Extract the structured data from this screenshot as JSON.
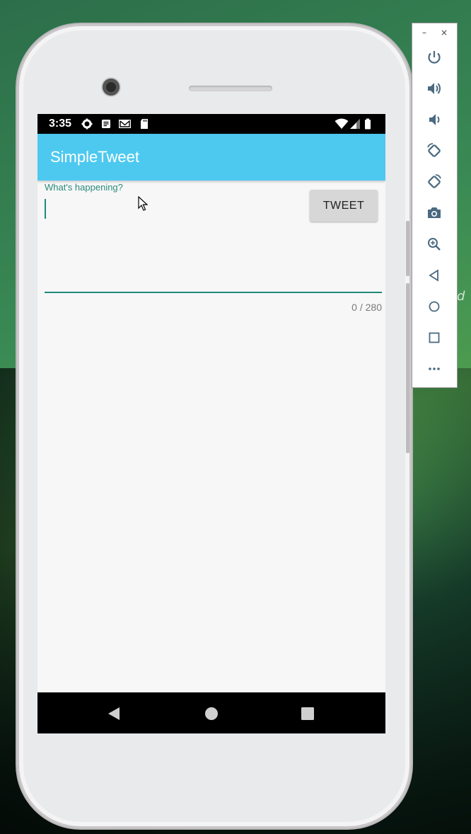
{
  "status_bar": {
    "time": "3:35"
  },
  "app_bar": {
    "title": "SimpleTweet"
  },
  "compose": {
    "hint": "What's happening?",
    "value": "",
    "counter": "0 / 280",
    "tweet_label": "TWEET"
  },
  "emulator_toolbar": {
    "minimize": "–",
    "close": "×",
    "icons": [
      "power-icon",
      "volume-up-icon",
      "volume-down-icon",
      "rotate-left-icon",
      "rotate-right-icon",
      "camera-icon",
      "zoom-icon",
      "back-icon",
      "home-icon",
      "overview-icon",
      "more-icon"
    ]
  },
  "colors": {
    "accent": "#4dc9f0",
    "teal": "#1f8a7a"
  }
}
